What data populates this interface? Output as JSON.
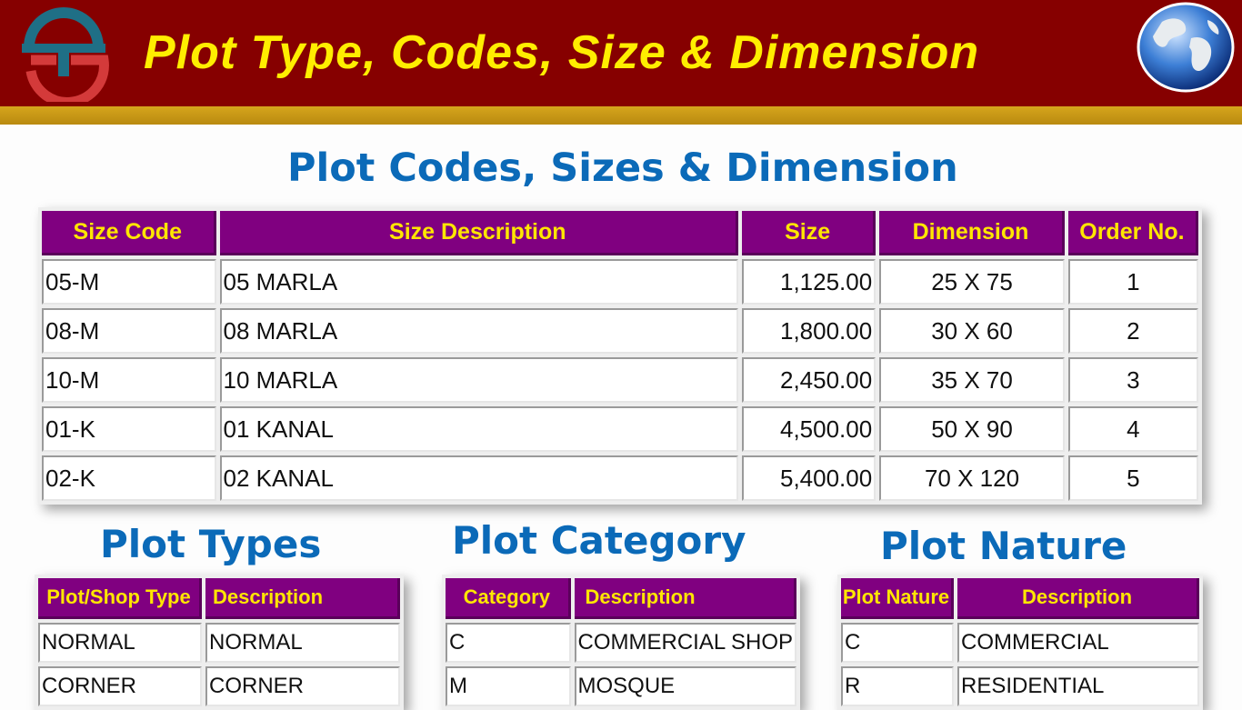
{
  "header": {
    "title": "Plot Type, Codes, Size & Dimension",
    "colors": {
      "banner": "#860000",
      "title": "#ffee00",
      "strip": "#d6a51c"
    },
    "logo_icon": "ts-logo-icon",
    "globe_icon": "globe-icon"
  },
  "codes": {
    "title": "Plot Codes, Sizes & Dimension",
    "columns": [
      "Size Code",
      "Size Description",
      "Size",
      "Dimension",
      "Order No."
    ],
    "rows": [
      [
        "05-M",
        "05 MARLA",
        "1,125.00",
        "25 X 75",
        "1"
      ],
      [
        "08-M",
        "08 MARLA",
        "1,800.00",
        "30 X 60",
        "2"
      ],
      [
        "10-M",
        "10 MARLA",
        "2,450.00",
        "35 X 70",
        "3"
      ],
      [
        "01-K",
        "01 KANAL",
        "4,500.00",
        "50 X 90",
        "4"
      ],
      [
        "02-K",
        "02 KANAL",
        "5,400.00",
        "70 X 120",
        "5"
      ]
    ]
  },
  "types": {
    "title": "Plot Types",
    "columns": [
      "Plot/Shop Type",
      "Description"
    ],
    "rows": [
      [
        "NORMAL",
        "NORMAL"
      ],
      [
        "CORNER",
        "CORNER"
      ]
    ]
  },
  "category": {
    "title": "Plot Category",
    "columns": [
      "Category",
      "Description"
    ],
    "rows": [
      [
        "C",
        "COMMERCIAL SHOP"
      ],
      [
        "M",
        "MOSQUE"
      ]
    ]
  },
  "nature": {
    "title": "Plot Nature",
    "columns": [
      "Plot Nature",
      "Description"
    ],
    "rows": [
      [
        "C",
        "COMMERCIAL"
      ],
      [
        "R",
        "RESIDENTIAL"
      ]
    ]
  },
  "accent_colors": {
    "section_title": "#0b6ab8",
    "table_header": "#800080",
    "table_header_text": "#ffe600"
  }
}
